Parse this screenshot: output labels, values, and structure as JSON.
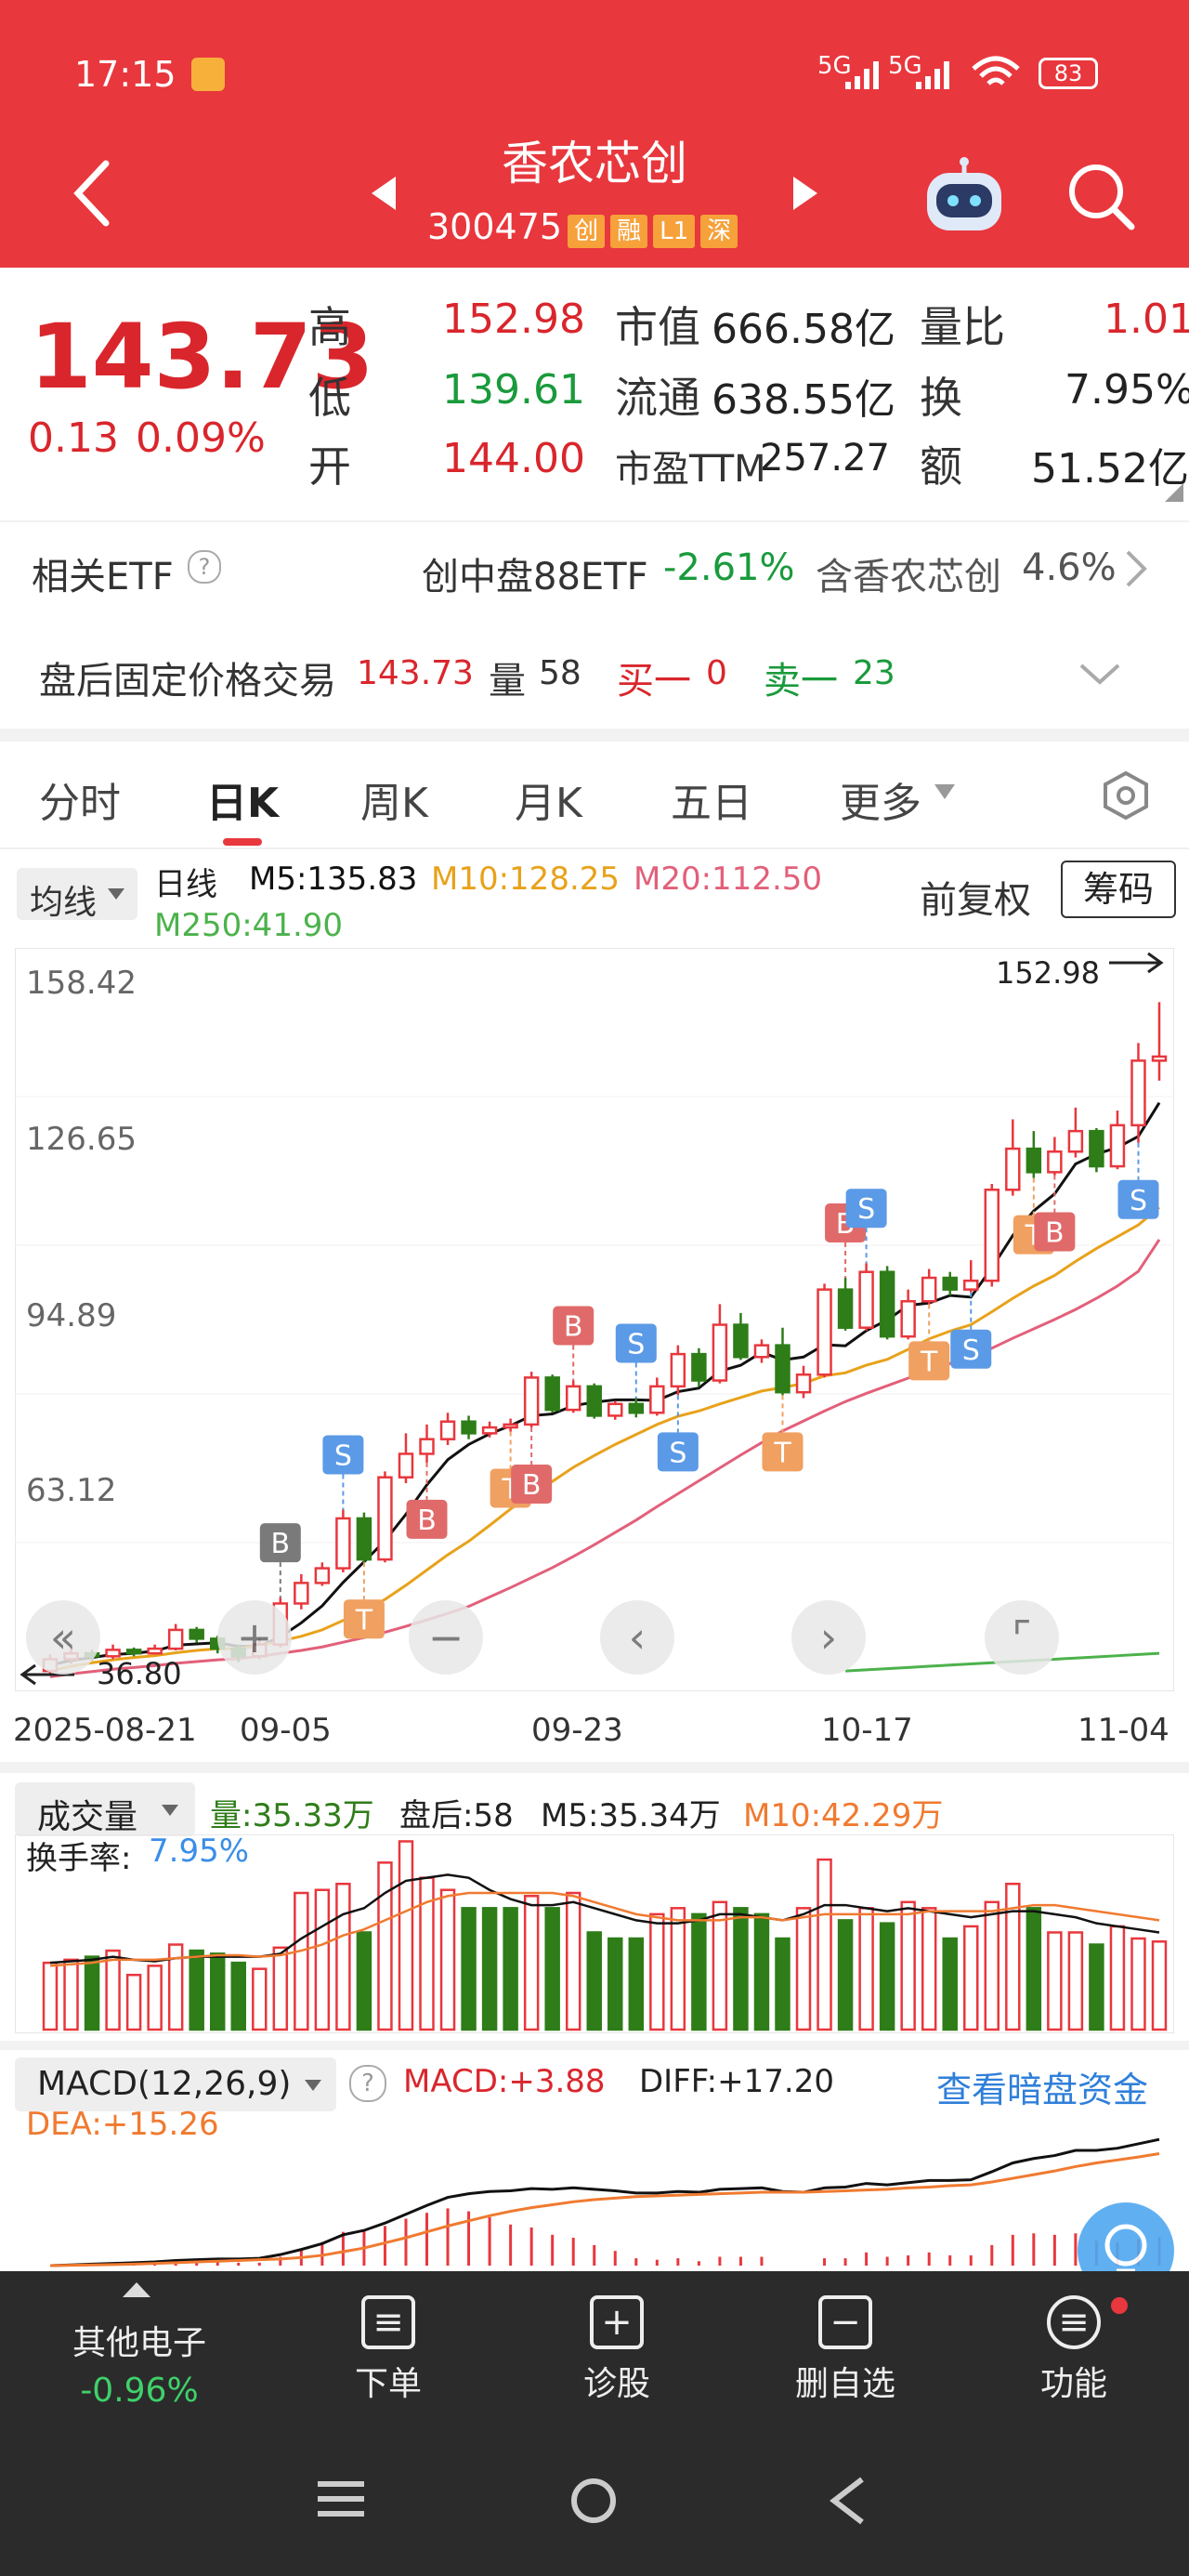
{
  "status_bar": {
    "time": "17:15",
    "signal1": "5G",
    "signal2": "5G",
    "battery": "83"
  },
  "header": {
    "stock_name": "香农芯创",
    "stock_code": "300475",
    "tags": [
      "创",
      "融",
      "L1",
      "深"
    ]
  },
  "quote": {
    "price": "143.73",
    "change": "0.13",
    "change_pct": "0.09%",
    "high_label": "高",
    "high": "152.98",
    "low_label": "低",
    "low": "139.61",
    "open_label": "开",
    "open": "144.00",
    "mktcap_label": "市值",
    "mktcap": "666.58亿",
    "float_label": "流通",
    "float": "638.55亿",
    "pe_label": "市盈TTM",
    "pe": "257.27",
    "vol_ratio_label": "量比",
    "vol_ratio": "1.01",
    "turnover_label": "换",
    "turnover": "7.95%",
    "amount_label": "额",
    "amount": "51.52亿"
  },
  "etf": {
    "label": "相关ETF",
    "name": "创中盘88ETF",
    "change": "-2.61%",
    "contain_text": "含香农芯创",
    "contain_pct": "4.6%"
  },
  "after_hours": {
    "label": "盘后固定价格交易",
    "price": "143.73",
    "vol_label": "量",
    "vol": "58",
    "buy_label": "买一",
    "buy": "0",
    "sell_label": "卖一",
    "sell": "23"
  },
  "tabs": [
    "分时",
    "日K",
    "周K",
    "月K",
    "五日",
    "更多"
  ],
  "active_tab": "日K",
  "ma_legend": {
    "selector": "均线",
    "period": "日线",
    "m5": "M5:135.83",
    "m10": "M10:128.25",
    "m20": "M20:112.50",
    "m250": "M250:41.90",
    "adjust": "前复权",
    "chips": "筹码"
  },
  "colors": {
    "up": "#e8373d",
    "down": "#2e7d18",
    "m5": "#111111",
    "m10": "#e8a21a",
    "m20": "#e2607a",
    "m250": "#4cb24c",
    "macd_dea": "#f07a30"
  },
  "chart_data": {
    "type": "candlestick",
    "y_ticks": [
      "158.42",
      "126.65",
      "94.89",
      "63.12"
    ],
    "high_marker": "152.98",
    "low_marker": "36.80",
    "x_labels": [
      "2025-08-21",
      "09-05",
      "09-23",
      "10-17",
      "11-04"
    ],
    "ylim": [
      36.8,
      158.42
    ],
    "candles": [
      [
        39.0,
        41.0,
        38.5,
        41.8
      ],
      [
        41.0,
        42.0,
        40.2,
        43.0
      ],
      [
        42.0,
        41.5,
        40.8,
        42.6
      ],
      [
        41.5,
        42.6,
        41.0,
        43.5
      ],
      [
        42.6,
        42.0,
        41.5,
        43.0
      ],
      [
        42.0,
        42.8,
        41.8,
        43.5
      ],
      [
        42.8,
        46.0,
        42.5,
        47.0
      ],
      [
        46.0,
        44.5,
        43.8,
        46.5
      ],
      [
        44.5,
        42.8,
        42.0,
        45.0
      ],
      [
        42.8,
        41.5,
        40.5,
        43.5
      ],
      [
        41.5,
        43.5,
        41.0,
        44.5
      ],
      [
        43.5,
        50.5,
        43.0,
        51.5
      ],
      [
        50.5,
        54.0,
        49.5,
        55.5
      ],
      [
        54.0,
        56.5,
        53.5,
        57.5
      ],
      [
        56.5,
        65.0,
        55.8,
        66.5
      ],
      [
        65.0,
        58.0,
        57.5,
        66.0
      ],
      [
        58.0,
        72.0,
        57.5,
        73.0
      ],
      [
        72.0,
        76.0,
        71.0,
        79.5
      ],
      [
        76.0,
        78.5,
        74.5,
        81.0
      ],
      [
        78.5,
        81.5,
        77.5,
        83.0
      ],
      [
        81.5,
        79.5,
        78.5,
        82.5
      ],
      [
        79.5,
        80.5,
        78.8,
        81.5
      ],
      [
        80.5,
        81.0,
        79.8,
        82.0
      ],
      [
        81.0,
        89.0,
        80.5,
        90.0
      ],
      [
        89.0,
        83.5,
        83.0,
        89.5
      ],
      [
        83.5,
        87.5,
        83.0,
        88.5
      ],
      [
        87.5,
        82.5,
        82.0,
        88.0
      ],
      [
        82.5,
        84.5,
        81.8,
        85.0
      ],
      [
        84.5,
        83.0,
        82.2,
        85.5
      ],
      [
        83.0,
        87.5,
        82.5,
        89.0
      ],
      [
        87.5,
        93.0,
        86.0,
        94.5
      ],
      [
        93.0,
        88.5,
        87.5,
        94.0
      ],
      [
        88.5,
        98.0,
        88.0,
        101.5
      ],
      [
        98.0,
        92.5,
        92.0,
        100.0
      ],
      [
        92.5,
        94.5,
        91.5,
        95.5
      ],
      [
        94.5,
        86.5,
        86.0,
        97.5
      ],
      [
        86.5,
        89.5,
        85.5,
        91.0
      ],
      [
        89.5,
        104.0,
        89.0,
        105.0
      ],
      [
        104.0,
        97.5,
        97.0,
        106.0
      ],
      [
        97.5,
        107.0,
        97.0,
        108.5
      ],
      [
        107.0,
        96.0,
        95.5,
        108.0
      ],
      [
        96.0,
        102.0,
        95.5,
        104.0
      ],
      [
        102.0,
        106.0,
        101.5,
        107.5
      ],
      [
        106.0,
        104.0,
        103.0,
        107.0
      ],
      [
        104.0,
        105.5,
        103.5,
        109.0
      ],
      [
        105.5,
        121.0,
        104.5,
        122.0
      ],
      [
        121.0,
        128.0,
        120.0,
        133.0
      ],
      [
        128.0,
        124.0,
        123.0,
        131.0
      ],
      [
        124.0,
        127.5,
        123.5,
        130.0
      ],
      [
        127.5,
        131.0,
        126.5,
        135.0
      ],
      [
        131.0,
        125.0,
        124.0,
        131.5
      ],
      [
        125.0,
        132.0,
        124.5,
        134.5
      ],
      [
        132.0,
        143.0,
        129.0,
        146.0
      ],
      [
        143.0,
        143.7,
        139.6,
        152.98
      ]
    ],
    "series": [
      {
        "name": "M5",
        "values": [
          40.0,
          40.8,
          41.3,
          41.8,
          42.0,
          42.4,
          43.4,
          43.6,
          43.8,
          43.2,
          43.2,
          44.8,
          47.2,
          50.1,
          54.1,
          57.6,
          61.2,
          65.7,
          70.7,
          75.0,
          77.6,
          79.4,
          80.8,
          82.5,
          82.8,
          84.2,
          84.8,
          85.2,
          85.2,
          85.1,
          86.6,
          87.2,
          90.1,
          91.1,
          93.3,
          92.0,
          92.5,
          94.6,
          94.4,
          97.0,
          98.8,
          101.3,
          101.7,
          103.0,
          102.7,
          107.7,
          113.2,
          117.4,
          120.3,
          125.4,
          127.1,
          128.2,
          130.1,
          135.83
        ]
      },
      {
        "name": "M10",
        "values": [
          39.0,
          39.8,
          40.4,
          40.9,
          41.3,
          41.6,
          42.1,
          42.5,
          42.8,
          42.8,
          43.3,
          44.1,
          44.9,
          46.0,
          47.6,
          49.2,
          51.2,
          53.6,
          56.2,
          58.8,
          61.1,
          63.8,
          66.6,
          69.1,
          71.3,
          73.7,
          75.7,
          77.6,
          79.3,
          81.0,
          82.4,
          83.3,
          84.5,
          85.6,
          86.7,
          87.3,
          88.0,
          89.3,
          89.8,
          91.1,
          92.1,
          93.8,
          95.6,
          96.9,
          98.0,
          100.2,
          102.5,
          104.6,
          106.4,
          108.8,
          111.0,
          113.0,
          115.0,
          118.0
        ]
      },
      {
        "name": "M20",
        "values": [
          38.0,
          38.5,
          38.9,
          39.3,
          39.6,
          39.9,
          40.3,
          40.6,
          40.9,
          41.1,
          41.5,
          42.0,
          42.5,
          43.1,
          43.9,
          44.7,
          45.6,
          46.6,
          47.7,
          48.8,
          50.0,
          51.6,
          53.2,
          54.9,
          56.6,
          58.5,
          60.5,
          62.6,
          64.7,
          67.0,
          69.2,
          71.4,
          73.6,
          75.8,
          77.9,
          79.9,
          81.6,
          83.3,
          84.9,
          86.3,
          87.6,
          88.9,
          90.1,
          91.4,
          92.6,
          94.0,
          95.7,
          97.3,
          98.9,
          100.6,
          102.5,
          104.6,
          107.1,
          112.5
        ]
      }
    ],
    "signals": [
      {
        "i": 11,
        "label": "B",
        "color": "#7a7a7a",
        "pos": "above"
      },
      {
        "i": 14,
        "label": "S",
        "color": "#5b9ae6",
        "pos": "above"
      },
      {
        "i": 15,
        "label": "T",
        "color": "#f0a060",
        "pos": "below"
      },
      {
        "i": 18,
        "label": "B",
        "color": "#e06a6a",
        "pos": "below"
      },
      {
        "i": 22,
        "label": "T",
        "color": "#f0a060",
        "pos": "below"
      },
      {
        "i": 23,
        "label": "B",
        "color": "#e06a6a",
        "pos": "below"
      },
      {
        "i": 25,
        "label": "B",
        "color": "#e06a6a",
        "pos": "above"
      },
      {
        "i": 28,
        "label": "S",
        "color": "#5b9ae6",
        "pos": "above"
      },
      {
        "i": 30,
        "label": "S",
        "color": "#5b9ae6",
        "pos": "below"
      },
      {
        "i": 35,
        "label": "T",
        "color": "#f0a060",
        "pos": "below"
      },
      {
        "i": 38,
        "label": "B",
        "color": "#e06a6a",
        "pos": "above"
      },
      {
        "i": 39,
        "label": "S",
        "color": "#5b9ae6",
        "pos": "above"
      },
      {
        "i": 42,
        "label": "T",
        "color": "#f0a060",
        "pos": "below"
      },
      {
        "i": 44,
        "label": "S",
        "color": "#5b9ae6",
        "pos": "below"
      },
      {
        "i": 47,
        "label": "T",
        "color": "#f0a060",
        "pos": "below"
      },
      {
        "i": 48,
        "label": "B",
        "color": "#e06a6a",
        "pos": "below"
      },
      {
        "i": 52,
        "label": "S",
        "color": "#5b9ae6",
        "pos": "below"
      }
    ],
    "volume_up": [
      true,
      true,
      false,
      true,
      true,
      true,
      true,
      false,
      false,
      false,
      true,
      true,
      true,
      true,
      true,
      false,
      true,
      true,
      true,
      true,
      false,
      false,
      false,
      true,
      false,
      true,
      false,
      false,
      false,
      true,
      true,
      false,
      true,
      false,
      false,
      false,
      true,
      true,
      false,
      true,
      false,
      true,
      true,
      false,
      true,
      true,
      true,
      false,
      true,
      true,
      false,
      true,
      true,
      true
    ],
    "volume": [
      22,
      23,
      24,
      26,
      18,
      21,
      28,
      26,
      25,
      22,
      20,
      27,
      45,
      46,
      48,
      32,
      55,
      62,
      50,
      46,
      40,
      40,
      40,
      44,
      40,
      45,
      32,
      30,
      30,
      38,
      40,
      38,
      42,
      40,
      38,
      30,
      40,
      56,
      36,
      40,
      35,
      42,
      40,
      30,
      34,
      42,
      48,
      40,
      32,
      32,
      28,
      34,
      30,
      29
    ],
    "volume_m5": [
      22,
      22.5,
      23,
      24,
      23,
      22.5,
      23.5,
      24,
      24,
      24,
      24,
      25,
      30,
      34,
      38,
      40,
      45,
      49,
      50,
      51,
      50,
      46,
      43,
      41,
      41,
      42,
      40,
      38,
      36,
      35,
      35,
      36,
      38,
      38,
      37,
      36,
      38,
      41,
      41,
      40,
      39,
      40,
      39,
      38,
      37,
      38,
      39,
      39,
      38,
      37,
      35,
      34,
      33,
      32
    ],
    "volume_m10": [
      21,
      21.5,
      22,
      23,
      23,
      23,
      23.5,
      24,
      24.5,
      24.5,
      24,
      24.5,
      26,
      28,
      31,
      33,
      36,
      39,
      42,
      44,
      45,
      45,
      45,
      45,
      45,
      44,
      42,
      40,
      38,
      37,
      36,
      36,
      36,
      37,
      37,
      36,
      37,
      38,
      38,
      38,
      38,
      38,
      39,
      39,
      39,
      39,
      40,
      41,
      41,
      40,
      39,
      38,
      37,
      36
    ]
  },
  "volume_panel": {
    "selector": "成交量",
    "vol": "量:35.33万",
    "after_hours": "盘后:58",
    "m5": "M5:35.34万",
    "m10": "M10:42.29万",
    "turnover_label": "换手率:",
    "turnover": "7.95%"
  },
  "macd_panel": {
    "selector": "MACD(12,26,9)",
    "macd": "MACD:+3.88",
    "diff": "DIFF:+17.20",
    "dea": "DEA:+15.26",
    "link": "查看暗盘资金",
    "diff_values": [
      0.0,
      0.1,
      0.2,
      0.3,
      0.4,
      0.5,
      0.7,
      0.8,
      0.9,
      0.9,
      1.0,
      1.5,
      2.2,
      3.0,
      4.2,
      4.8,
      5.8,
      7.0,
      8.2,
      9.3,
      9.8,
      10.1,
      10.2,
      10.5,
      10.4,
      10.6,
      10.4,
      10.2,
      9.9,
      9.9,
      10.1,
      10.0,
      10.4,
      10.5,
      10.6,
      10.1,
      10.0,
      10.6,
      10.7,
      11.2,
      11.0,
      11.3,
      11.6,
      11.6,
      11.7,
      12.8,
      14.0,
      14.6,
      15.0,
      15.7,
      15.7,
      16.0,
      16.6,
      17.2
    ],
    "dea_values": [
      0.0,
      0.05,
      0.1,
      0.15,
      0.2,
      0.3,
      0.4,
      0.5,
      0.6,
      0.7,
      0.8,
      0.9,
      1.1,
      1.4,
      1.9,
      2.4,
      3.1,
      3.8,
      4.6,
      5.4,
      6.1,
      6.8,
      7.4,
      7.9,
      8.3,
      8.7,
      9.0,
      9.2,
      9.4,
      9.5,
      9.6,
      9.7,
      9.8,
      9.9,
      10.0,
      10.0,
      10.0,
      10.1,
      10.2,
      10.3,
      10.4,
      10.6,
      10.7,
      10.9,
      11.0,
      11.4,
      11.9,
      12.4,
      12.9,
      13.5,
      14.0,
      14.4,
      14.8,
      15.26
    ]
  },
  "bottom_nav": {
    "sector_name": "其他电子",
    "sector_change": "-0.96%",
    "items": [
      "下单",
      "诊股",
      "删自选",
      "功能"
    ]
  }
}
